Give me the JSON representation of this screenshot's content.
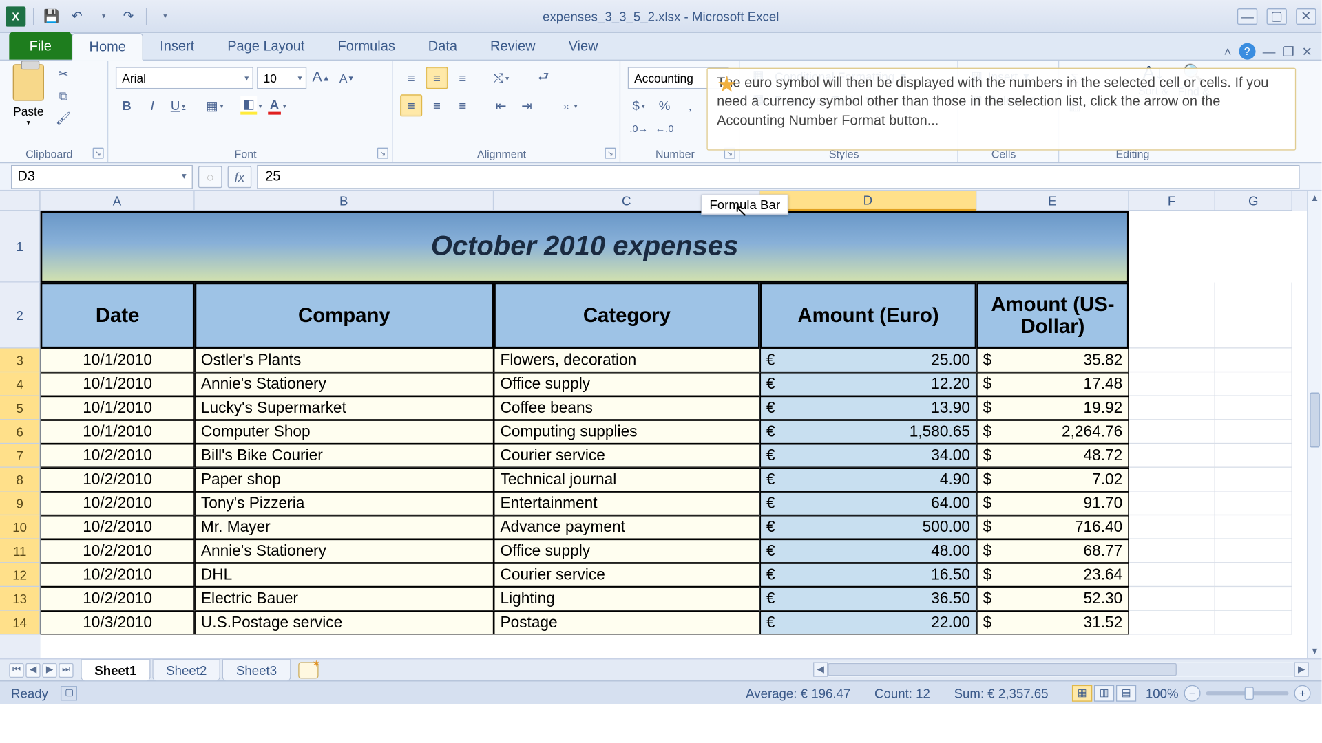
{
  "titlebar": {
    "title": "expenses_3_3_5_2.xlsx - Microsoft Excel"
  },
  "tabs": {
    "file": "File",
    "list": [
      "Home",
      "Insert",
      "Page Layout",
      "Formulas",
      "Data",
      "Review",
      "View"
    ],
    "active": "Home"
  },
  "ribbon": {
    "clipboard": {
      "label": "Clipboard",
      "paste": "Paste"
    },
    "font": {
      "label": "Font",
      "name": "Arial",
      "size": "10"
    },
    "alignment": {
      "label": "Alignment"
    },
    "number": {
      "label": "Number",
      "format": "Accounting"
    },
    "styles": {
      "conditional": "Conditional Formatting",
      "table": "Format as Table",
      "label": "Styles"
    },
    "cells": {
      "insert": "Insert",
      "delete": "Delete",
      "label": "Cells"
    },
    "editing": {
      "sort": "Sort &",
      "find": "Find &",
      "label": "Editing"
    }
  },
  "tooltip": {
    "text": "The euro symbol will then be displayed with the numbers in the selected cell or cells. If you need a currency symbol other than those in the selection list, click the arrow on the Accounting Number Format button..."
  },
  "formulabar": {
    "namebox": "D3",
    "value": "25",
    "callout": "Formula Bar"
  },
  "columns": [
    "A",
    "B",
    "C",
    "D",
    "E",
    "F",
    "G"
  ],
  "sheet": {
    "title": "October 2010 expenses",
    "headers": {
      "A": "Date",
      "B": "Company",
      "C": "Category",
      "D": "Amount (Euro)",
      "E": "Amount (US-Dollar)"
    },
    "rows": [
      {
        "n": 3,
        "date": "10/1/2010",
        "company": "Ostler's Plants",
        "category": "Flowers, decoration",
        "euro": "25.00",
        "usd": "35.82"
      },
      {
        "n": 4,
        "date": "10/1/2010",
        "company": "Annie's Stationery",
        "category": "Office supply",
        "euro": "12.20",
        "usd": "17.48"
      },
      {
        "n": 5,
        "date": "10/1/2010",
        "company": "Lucky's Supermarket",
        "category": "Coffee beans",
        "euro": "13.90",
        "usd": "19.92"
      },
      {
        "n": 6,
        "date": "10/1/2010",
        "company": "Computer Shop",
        "category": "Computing supplies",
        "euro": "1,580.65",
        "usd": "2,264.76"
      },
      {
        "n": 7,
        "date": "10/2/2010",
        "company": "Bill's Bike Courier",
        "category": "Courier service",
        "euro": "34.00",
        "usd": "48.72"
      },
      {
        "n": 8,
        "date": "10/2/2010",
        "company": "Paper shop",
        "category": "Technical journal",
        "euro": "4.90",
        "usd": "7.02"
      },
      {
        "n": 9,
        "date": "10/2/2010",
        "company": "Tony's Pizzeria",
        "category": "Entertainment",
        "euro": "64.00",
        "usd": "91.70"
      },
      {
        "n": 10,
        "date": "10/2/2010",
        "company": "Mr. Mayer",
        "category": "Advance payment",
        "euro": "500.00",
        "usd": "716.40"
      },
      {
        "n": 11,
        "date": "10/2/2010",
        "company": "Annie's Stationery",
        "category": "Office supply",
        "euro": "48.00",
        "usd": "68.77"
      },
      {
        "n": 12,
        "date": "10/2/2010",
        "company": "DHL",
        "category": "Courier service",
        "euro": "16.50",
        "usd": "23.64"
      },
      {
        "n": 13,
        "date": "10/2/2010",
        "company": "Electric Bauer",
        "category": "Lighting",
        "euro": "36.50",
        "usd": "52.30"
      },
      {
        "n": 14,
        "date": "10/3/2010",
        "company": "U.S.Postage service",
        "category": "Postage",
        "euro": "22.00",
        "usd": "31.52"
      }
    ]
  },
  "sheets": {
    "active": "Sheet1",
    "list": [
      "Sheet1",
      "Sheet2",
      "Sheet3"
    ]
  },
  "status": {
    "ready": "Ready",
    "average": "Average:  € 196.47",
    "count": "Count: 12",
    "sum": "Sum:  € 2,357.65",
    "zoom": "100%"
  }
}
